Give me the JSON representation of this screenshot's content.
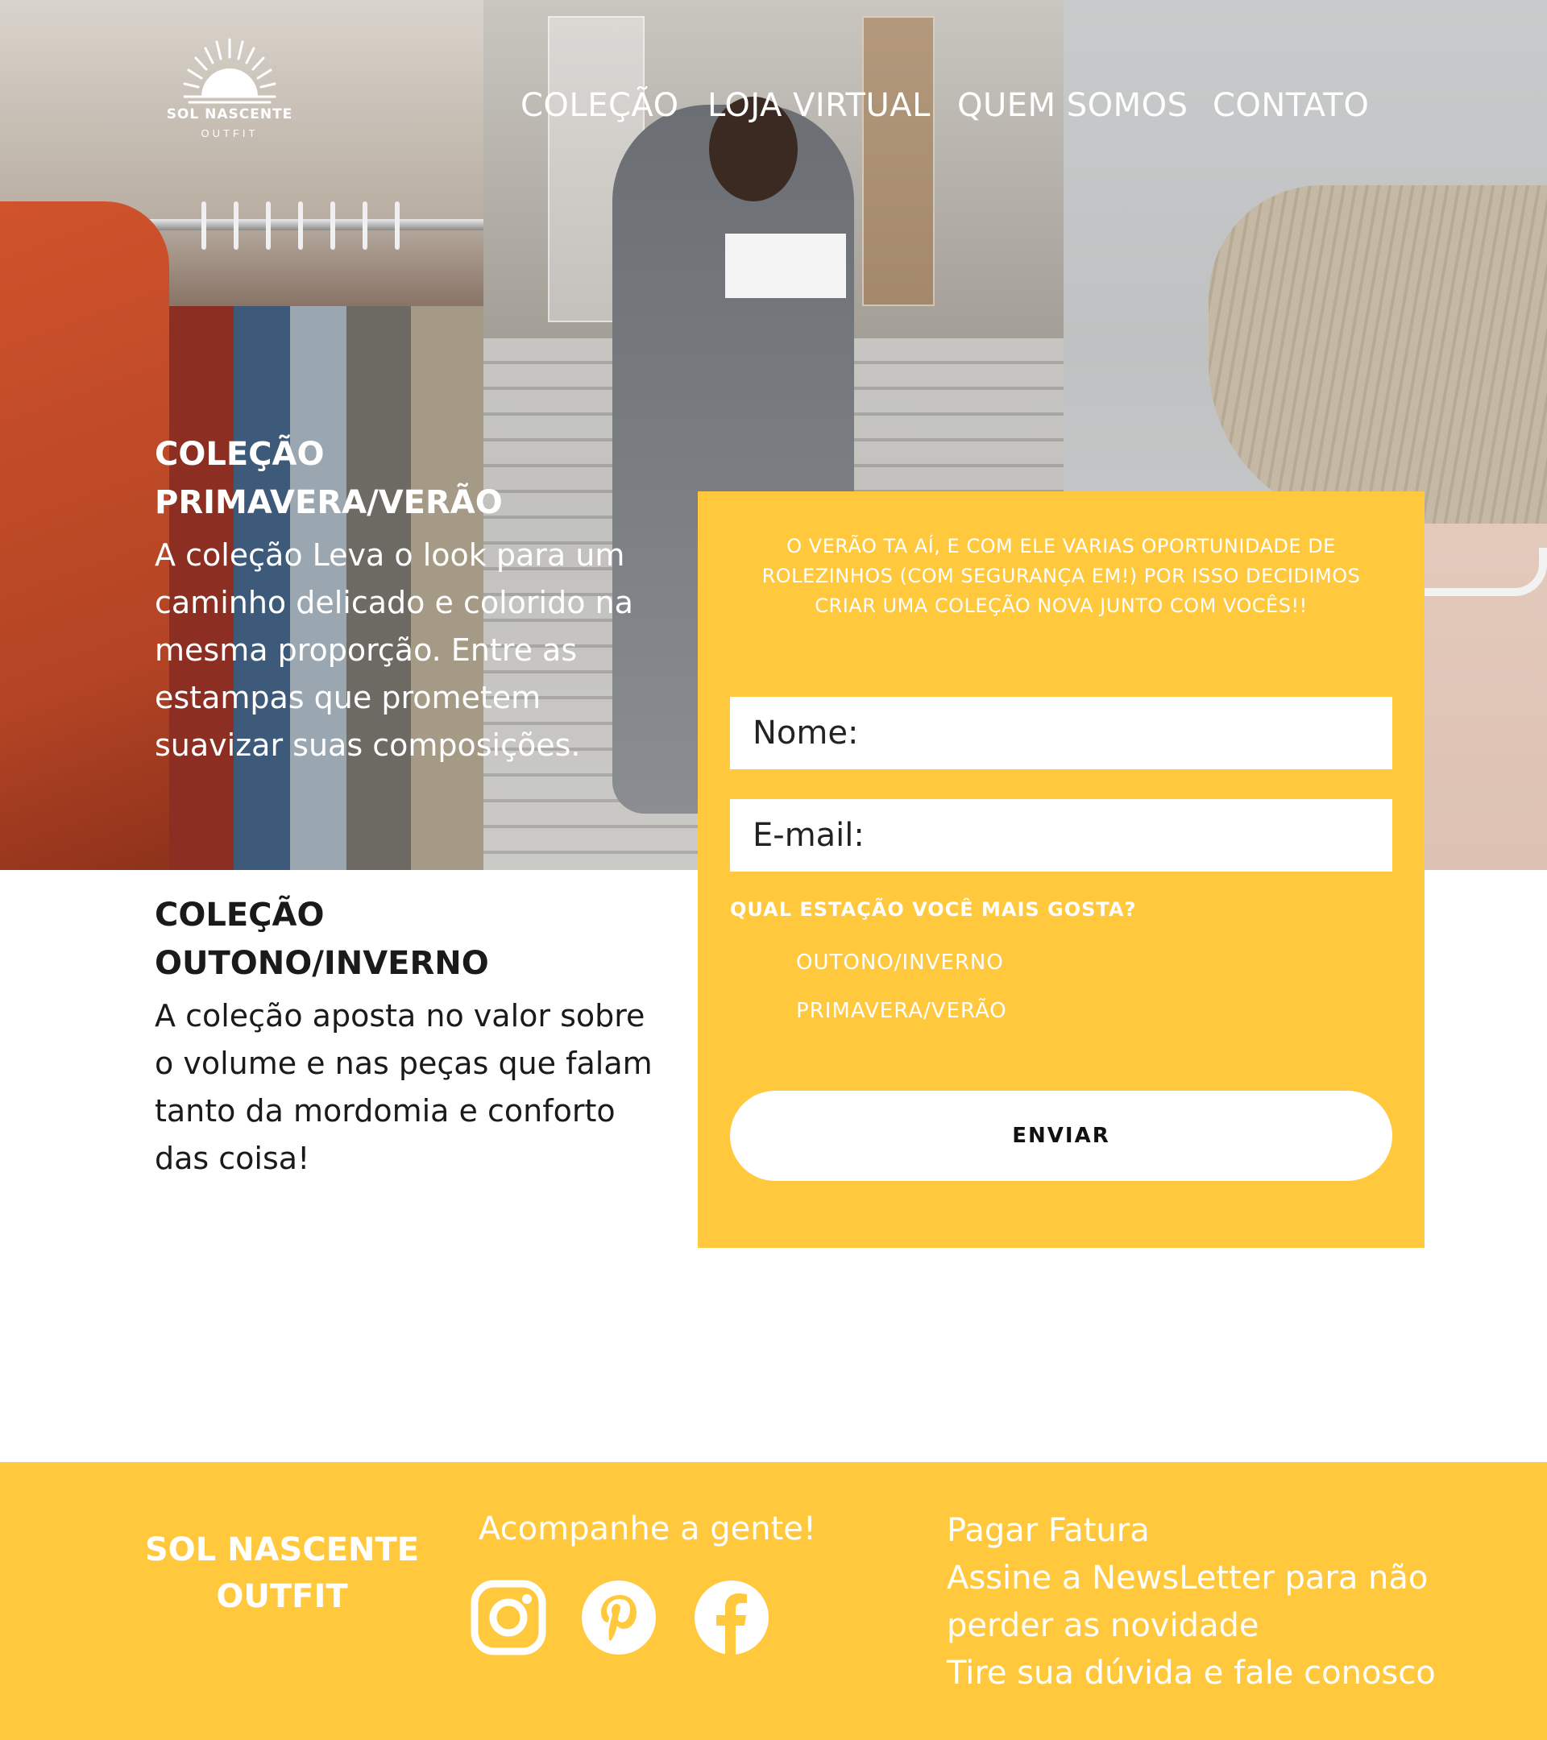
{
  "brand": {
    "name": "SOL NASCENTE",
    "subtitle": "OUTFIT"
  },
  "nav": {
    "items": [
      {
        "label": "COLEÇÃO"
      },
      {
        "label": "LOJA VIRTUAL"
      },
      {
        "label": "QUEM SOMOS"
      },
      {
        "label": "CONTATO"
      }
    ]
  },
  "hero": {
    "collection_title": "COLEÇÃO PRIMAVERA/VERÃO",
    "collection_text": "A coleção Leva o look para um caminho delicado e colorido na mesma proporção. Entre as estampas que prometem suavizar suas composições."
  },
  "form": {
    "intro": "O VERÃO TA AÍ, E COM ELE VARIAS OPORTUNIDADE DE ROLEZINHOS (COM SEGURANÇA EM!) POR ISSO DECIDIMOS CRIAR UMA COLEÇÃO NOVA JUNTO COM VOCÊS!!",
    "name_placeholder": "Nome:",
    "email_placeholder": "E-mail:",
    "question": "QUAL ESTAÇÃO VOCÊ MAIS GOSTA?",
    "options": [
      "OUTONO/INVERNO",
      "PRIMAVERA/VERÃO"
    ],
    "submit_label": "ENVIAR"
  },
  "section2": {
    "collection_title": "COLEÇÃO OUTONO/INVERNO",
    "collection_text": "A coleção aposta no valor sobre o volume e nas peças que falam tanto da mordomia e conforto das coisa!"
  },
  "footer": {
    "brand": "SOL NASCENTE OUTFIT",
    "follow_label": "Acompanhe a gente!",
    "social": [
      "instagram-icon",
      "pinterest-icon",
      "facebook-icon"
    ],
    "links": [
      "Pagar Fatura",
      "Assine a NewsLetter para  não perder as novidade",
      "Tire sua dúvida e fale conosco"
    ]
  },
  "colors": {
    "accent": "#ffc83d",
    "text_dark": "#1a1a1a",
    "white": "#ffffff"
  }
}
